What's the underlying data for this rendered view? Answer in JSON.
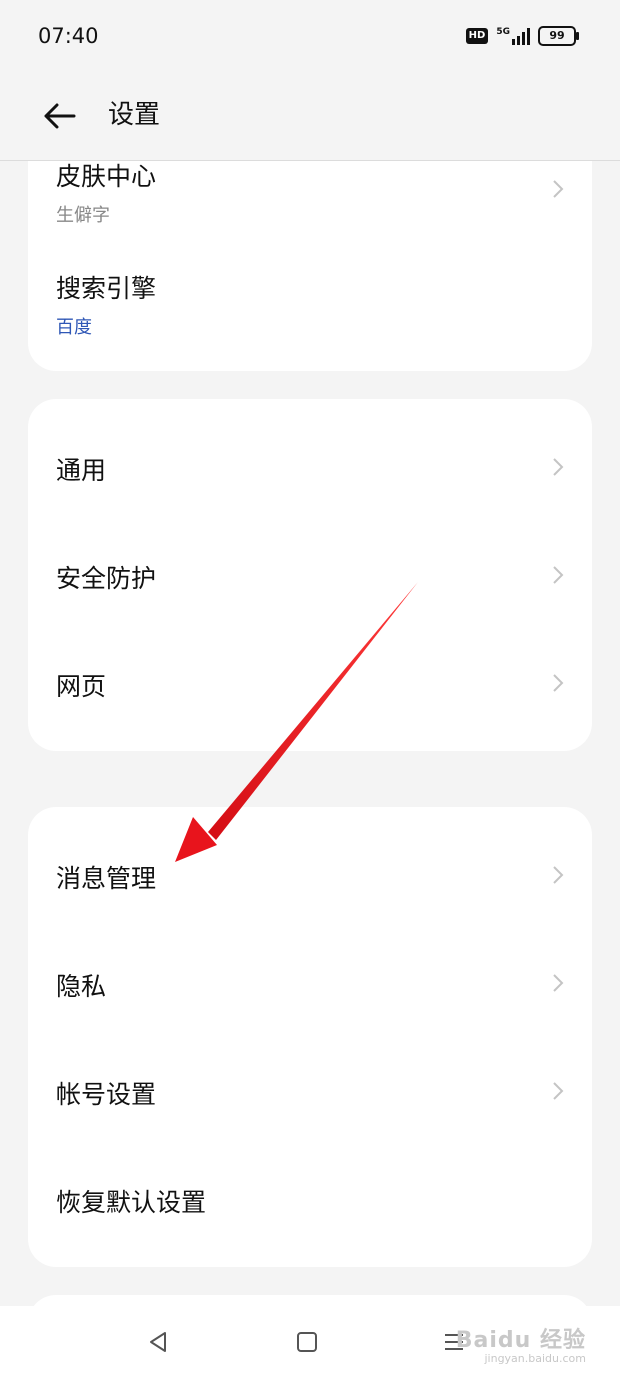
{
  "status_bar": {
    "time": "07:40",
    "hd_label": "HD",
    "network_label": "5G",
    "battery_level": "99"
  },
  "header": {
    "title": "设置"
  },
  "card1": {
    "items": [
      {
        "label": "皮肤中心",
        "sub": "生僻字"
      },
      {
        "label": "搜索引擎",
        "sub": "百度"
      }
    ]
  },
  "card2": {
    "items": [
      {
        "label": "通用"
      },
      {
        "label": "安全防护"
      },
      {
        "label": "网页"
      }
    ]
  },
  "card3": {
    "items": [
      {
        "label": "消息管理"
      },
      {
        "label": "隐私"
      },
      {
        "label": "帐号设置"
      },
      {
        "label": "恢复默认设置"
      }
    ]
  },
  "watermark": {
    "brand": "Baidu 经验",
    "url": "jingyan.baidu.com"
  },
  "colors": {
    "background": "#f4f4f4",
    "card": "#ffffff",
    "link_blue": "#2f57b6",
    "annotation_arrow": "#e8141c"
  }
}
